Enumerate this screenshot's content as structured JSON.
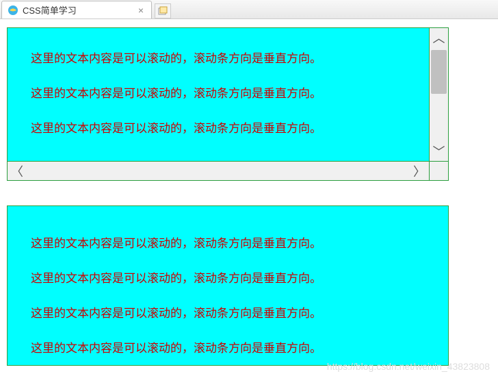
{
  "browser": {
    "tab_title": "CSS简单学习",
    "close_glyph": "×"
  },
  "content": {
    "repeated_line": "这里的文本内容是可以滚动的，滚动条方向是垂直方向。",
    "box1_lines": [
      "这里的文本内容是可以滚动的，滚动条方向是垂直方向。",
      "这里的文本内容是可以滚动的，滚动条方向是垂直方向。",
      "这里的文本内容是可以滚动的，滚动条方向是垂直方向。"
    ],
    "box2_lines": [
      "这里的文本内容是可以滚动的，滚动条方向是垂直方向。",
      "这里的文本内容是可以滚动的，滚动条方向是垂直方向。",
      "这里的文本内容是可以滚动的，滚动条方向是垂直方向。",
      "这里的文本内容是可以滚动的，滚动条方向是垂直方向。"
    ]
  },
  "scroll": {
    "up_glyph": "︿",
    "down_glyph": "﹀",
    "left_glyph": "〈",
    "right_glyph": "〉"
  },
  "watermark": "https://blog.csdn.net/weixin_43823808",
  "colors": {
    "box_bg": "#00ffff",
    "box_border": "#2a9e3d",
    "text_color": "#cc0000"
  }
}
